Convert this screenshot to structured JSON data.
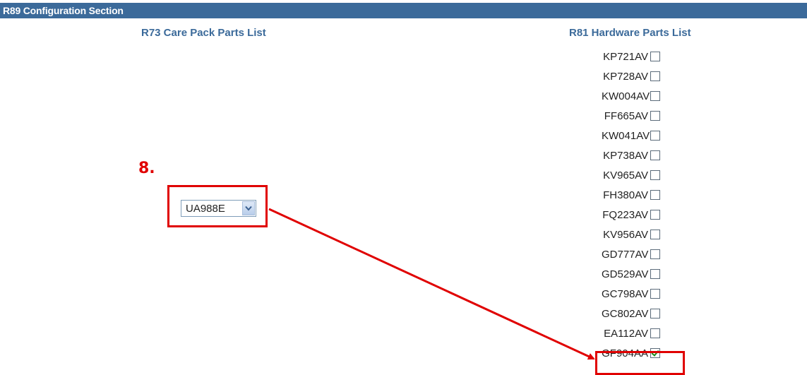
{
  "section": {
    "title": "R89 Configuration Section"
  },
  "columns": {
    "care_pack_heading": "R73 Care Pack Parts List",
    "hardware_heading": "R81 Hardware Parts List"
  },
  "care_pack_select": {
    "selected_value": "UA988E"
  },
  "hardware_parts": [
    {
      "label": "KP721AV",
      "checked": false
    },
    {
      "label": "KP728AV",
      "checked": false
    },
    {
      "label": "KW004AV",
      "checked": false
    },
    {
      "label": "FF665AV",
      "checked": false
    },
    {
      "label": "KW041AV",
      "checked": false
    },
    {
      "label": "KP738AV",
      "checked": false
    },
    {
      "label": "KV965AV",
      "checked": false
    },
    {
      "label": "FH380AV",
      "checked": false
    },
    {
      "label": "FQ223AV",
      "checked": false
    },
    {
      "label": "KV956AV",
      "checked": false
    },
    {
      "label": "GD777AV",
      "checked": false
    },
    {
      "label": "GD529AV",
      "checked": false
    },
    {
      "label": "GC798AV",
      "checked": false
    },
    {
      "label": "GC802AV",
      "checked": false
    },
    {
      "label": "EA112AV",
      "checked": false
    },
    {
      "label": "GF904AA",
      "checked": true
    }
  ],
  "annotation": {
    "step_label": "8.",
    "color": "#e00000"
  },
  "colors": {
    "header_bar": "#3b6a9a",
    "heading_text": "#3b6a9a",
    "checkmark": "#1c8c1c"
  },
  "icons": {
    "select_arrow": "chevron-down-icon",
    "checked_box": "checkbox-checked-icon",
    "unchecked_box": "checkbox-unchecked-icon"
  }
}
